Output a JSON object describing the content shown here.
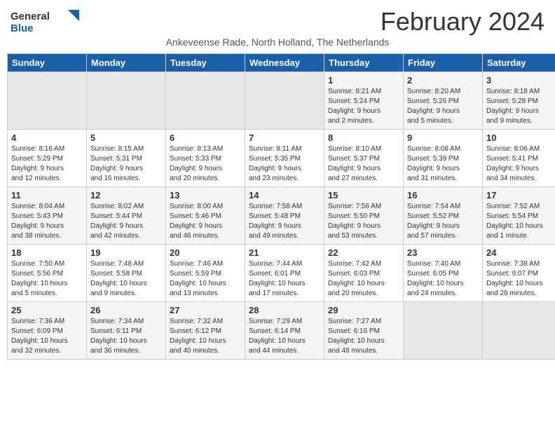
{
  "header": {
    "logo_general": "General",
    "logo_blue": "Blue",
    "month_year": "February 2024",
    "location": "Ankeveense Rade, North Holland, The Netherlands"
  },
  "days_of_week": [
    "Sunday",
    "Monday",
    "Tuesday",
    "Wednesday",
    "Thursday",
    "Friday",
    "Saturday"
  ],
  "weeks": [
    [
      {
        "day": "",
        "info": ""
      },
      {
        "day": "",
        "info": ""
      },
      {
        "day": "",
        "info": ""
      },
      {
        "day": "",
        "info": ""
      },
      {
        "day": "1",
        "info": "Sunrise: 8:21 AM\nSunset: 5:24 PM\nDaylight: 9 hours\nand 2 minutes."
      },
      {
        "day": "2",
        "info": "Sunrise: 8:20 AM\nSunset: 5:26 PM\nDaylight: 9 hours\nand 5 minutes."
      },
      {
        "day": "3",
        "info": "Sunrise: 8:18 AM\nSunset: 5:28 PM\nDaylight: 9 hours\nand 9 minutes."
      }
    ],
    [
      {
        "day": "4",
        "info": "Sunrise: 8:16 AM\nSunset: 5:29 PM\nDaylight: 9 hours\nand 12 minutes."
      },
      {
        "day": "5",
        "info": "Sunrise: 8:15 AM\nSunset: 5:31 PM\nDaylight: 9 hours\nand 16 minutes."
      },
      {
        "day": "6",
        "info": "Sunrise: 8:13 AM\nSunset: 5:33 PM\nDaylight: 9 hours\nand 20 minutes."
      },
      {
        "day": "7",
        "info": "Sunrise: 8:11 AM\nSunset: 5:35 PM\nDaylight: 9 hours\nand 23 minutes."
      },
      {
        "day": "8",
        "info": "Sunrise: 8:10 AM\nSunset: 5:37 PM\nDaylight: 9 hours\nand 27 minutes."
      },
      {
        "day": "9",
        "info": "Sunrise: 8:08 AM\nSunset: 5:39 PM\nDaylight: 9 hours\nand 31 minutes."
      },
      {
        "day": "10",
        "info": "Sunrise: 8:06 AM\nSunset: 5:41 PM\nDaylight: 9 hours\nand 34 minutes."
      }
    ],
    [
      {
        "day": "11",
        "info": "Sunrise: 8:04 AM\nSunset: 5:43 PM\nDaylight: 9 hours\nand 38 minutes."
      },
      {
        "day": "12",
        "info": "Sunrise: 8:02 AM\nSunset: 5:44 PM\nDaylight: 9 hours\nand 42 minutes."
      },
      {
        "day": "13",
        "info": "Sunrise: 8:00 AM\nSunset: 5:46 PM\nDaylight: 9 hours\nand 46 minutes."
      },
      {
        "day": "14",
        "info": "Sunrise: 7:58 AM\nSunset: 5:48 PM\nDaylight: 9 hours\nand 49 minutes."
      },
      {
        "day": "15",
        "info": "Sunrise: 7:56 AM\nSunset: 5:50 PM\nDaylight: 9 hours\nand 53 minutes."
      },
      {
        "day": "16",
        "info": "Sunrise: 7:54 AM\nSunset: 5:52 PM\nDaylight: 9 hours\nand 57 minutes."
      },
      {
        "day": "17",
        "info": "Sunrise: 7:52 AM\nSunset: 5:54 PM\nDaylight: 10 hours\nand 1 minute."
      }
    ],
    [
      {
        "day": "18",
        "info": "Sunrise: 7:50 AM\nSunset: 5:56 PM\nDaylight: 10 hours\nand 5 minutes."
      },
      {
        "day": "19",
        "info": "Sunrise: 7:48 AM\nSunset: 5:58 PM\nDaylight: 10 hours\nand 9 minutes."
      },
      {
        "day": "20",
        "info": "Sunrise: 7:46 AM\nSunset: 5:59 PM\nDaylight: 10 hours\nand 13 minutes."
      },
      {
        "day": "21",
        "info": "Sunrise: 7:44 AM\nSunset: 6:01 PM\nDaylight: 10 hours\nand 17 minutes."
      },
      {
        "day": "22",
        "info": "Sunrise: 7:42 AM\nSunset: 6:03 PM\nDaylight: 10 hours\nand 20 minutes."
      },
      {
        "day": "23",
        "info": "Sunrise: 7:40 AM\nSunset: 6:05 PM\nDaylight: 10 hours\nand 24 minutes."
      },
      {
        "day": "24",
        "info": "Sunrise: 7:38 AM\nSunset: 6:07 PM\nDaylight: 10 hours\nand 28 minutes."
      }
    ],
    [
      {
        "day": "25",
        "info": "Sunrise: 7:36 AM\nSunset: 6:09 PM\nDaylight: 10 hours\nand 32 minutes."
      },
      {
        "day": "26",
        "info": "Sunrise: 7:34 AM\nSunset: 6:11 PM\nDaylight: 10 hours\nand 36 minutes."
      },
      {
        "day": "27",
        "info": "Sunrise: 7:32 AM\nSunset: 6:12 PM\nDaylight: 10 hours\nand 40 minutes."
      },
      {
        "day": "28",
        "info": "Sunrise: 7:29 AM\nSunset: 6:14 PM\nDaylight: 10 hours\nand 44 minutes."
      },
      {
        "day": "29",
        "info": "Sunrise: 7:27 AM\nSunset: 6:16 PM\nDaylight: 10 hours\nand 48 minutes."
      },
      {
        "day": "",
        "info": ""
      },
      {
        "day": "",
        "info": ""
      }
    ]
  ]
}
